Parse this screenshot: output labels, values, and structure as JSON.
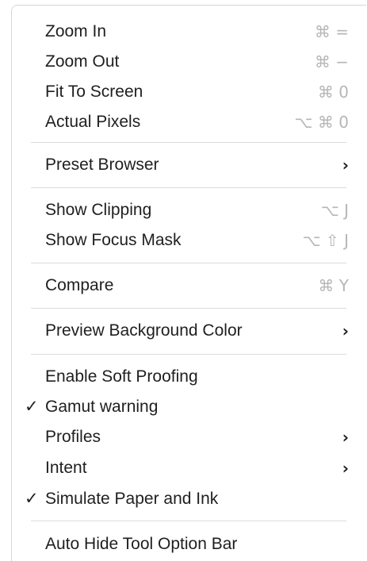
{
  "menu": {
    "items": [
      {
        "label": "Zoom In",
        "shortcut": "⌘ ="
      },
      {
        "label": "Zoom Out",
        "shortcut": "⌘ −"
      },
      {
        "label": "Fit To Screen",
        "shortcut": "⌘ 0"
      },
      {
        "label": "Actual Pixels",
        "shortcut": "⌥ ⌘ 0"
      },
      {
        "label": "Preset Browser",
        "submenu": "›"
      },
      {
        "label": "Show Clipping",
        "shortcut": "⌥ J"
      },
      {
        "label": "Show Focus Mask",
        "shortcut": "⌥ ⇧ J"
      },
      {
        "label": "Compare",
        "shortcut": "⌘ Y"
      },
      {
        "label": "Preview Background Color",
        "submenu": "›"
      },
      {
        "label": "Enable Soft Proofing"
      },
      {
        "label": "Gamut warning",
        "check": "✓"
      },
      {
        "label": "Profiles",
        "submenu": "›"
      },
      {
        "label": "Intent",
        "submenu": "›"
      },
      {
        "label": "Simulate Paper and Ink",
        "check": "✓"
      },
      {
        "label": "Auto Hide Tool Option Bar"
      }
    ]
  },
  "colors": {
    "text": "#1f1f1f",
    "shortcut": "#b6b6b6",
    "separator": "#dcdcdc"
  }
}
